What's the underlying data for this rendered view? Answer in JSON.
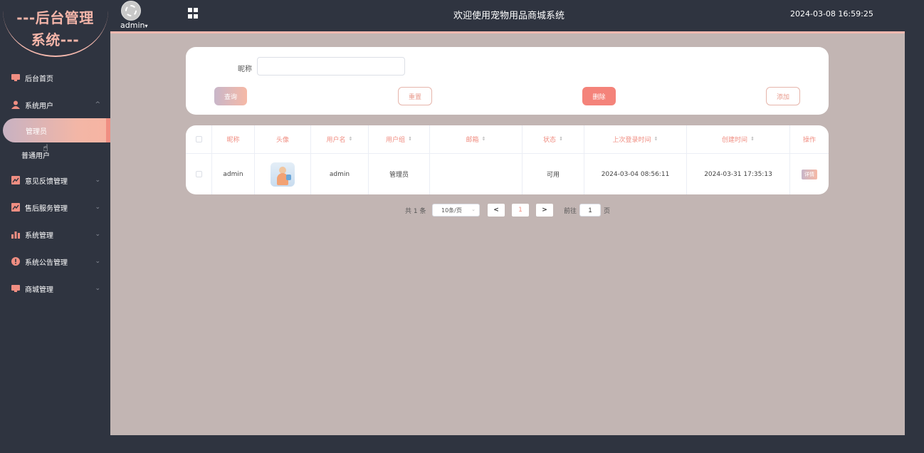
{
  "logo": {
    "line1": "---后台管理",
    "line2": "系统---"
  },
  "header": {
    "user": "admin",
    "user_caret": "▾",
    "title": "欢迎使用宠物用品商城系统",
    "datetime": "2024-03-08 16:59:25"
  },
  "sidebar": {
    "items": [
      {
        "label": "后台首页",
        "icon": "monitor-icon"
      },
      {
        "label": "系统用户",
        "icon": "user-icon",
        "expanded": true,
        "children": [
          {
            "label": "管理员",
            "active": true
          },
          {
            "label": "普通用户"
          }
        ]
      },
      {
        "label": "意见反馈管理",
        "icon": "chart-icon"
      },
      {
        "label": "售后服务管理",
        "icon": "chart-icon"
      },
      {
        "label": "系统管理",
        "icon": "bar-chart-icon"
      },
      {
        "label": "系统公告管理",
        "icon": "info-icon"
      },
      {
        "label": "商城管理",
        "icon": "monitor-icon"
      }
    ],
    "chevron_up": "^",
    "chevron_down": "⌄"
  },
  "search": {
    "nickname_label": "昵称",
    "nickname_value": "",
    "query_label": "查询",
    "reset_label": "重置",
    "delete_label": "删除",
    "add_label": "添加"
  },
  "table": {
    "columns": [
      "昵称",
      "头像",
      "用户名",
      "用户组",
      "邮箱",
      "状态",
      "上次登录时间",
      "创建时间",
      "操作"
    ],
    "sort_icon": "⇕",
    "rows": [
      {
        "nickname": "admin",
        "username": "admin",
        "group": "管理员",
        "email": "",
        "status": "可用",
        "last_login": "2024-03-04 08:56:11",
        "created": "2024-03-31 17:35:13",
        "action": "详情"
      }
    ]
  },
  "pagination": {
    "total": "共 1 条",
    "page_size": "10条/页",
    "prev": "<",
    "current": "1",
    "next": ">",
    "goto_label": "前往",
    "goto_value": "1",
    "page_suffix": "页"
  },
  "colors": {
    "accent": "#f08e82",
    "sidebar_bg": "#2f3440",
    "main_bg": "#c2b5b3",
    "delete_btn": "#f4837a"
  }
}
